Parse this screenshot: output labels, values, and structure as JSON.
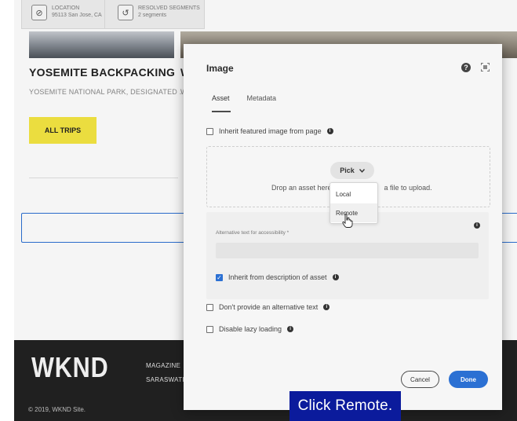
{
  "context_bar": {
    "location": {
      "icon": "location-off-icon",
      "label": "LOCATION",
      "value": "95113 San Jose, CA"
    },
    "segments": {
      "icon": "history-icon",
      "label": "RESOLVED SEGMENTS",
      "value": "2 segments"
    }
  },
  "page": {
    "card_title": "YOSEMITE BACKPACKING",
    "card_title_2": "W",
    "card_subtitle": "YOSEMITE NATIONAL PARK, DESIGNATED ...",
    "card_subtitle_2": "W",
    "trips_button": "ALL TRIPS"
  },
  "footer": {
    "logo": "WKND",
    "link_1": "MAGAZINE",
    "link_2": "SARASWATI",
    "copyright": "© 2019, WKND Site."
  },
  "dialog": {
    "title": "Image",
    "tabs": [
      {
        "label": "Asset",
        "active": true
      },
      {
        "label": "Metadata",
        "active": false
      }
    ],
    "inherit_featured": {
      "label": "Inherit featured image from page",
      "checked": false
    },
    "drop_text_left": "Drop an asset here",
    "drop_text_right": "a file to upload.",
    "pick_button": "Pick",
    "pick_menu": [
      "Local",
      "Remote"
    ],
    "alt_text_label": "Alternative text for accessibility *",
    "alt_text_value": "",
    "inherit_description": {
      "label": "Inherit from description of asset",
      "checked": true
    },
    "no_alt_text": {
      "label": "Don't provide an alternative text",
      "checked": false
    },
    "disable_lazy": {
      "label": "Disable lazy loading",
      "checked": false
    },
    "cancel_button": "Cancel",
    "done_button": "Done",
    "accent_color": "#2b70d3"
  },
  "caption": "Click Remote."
}
